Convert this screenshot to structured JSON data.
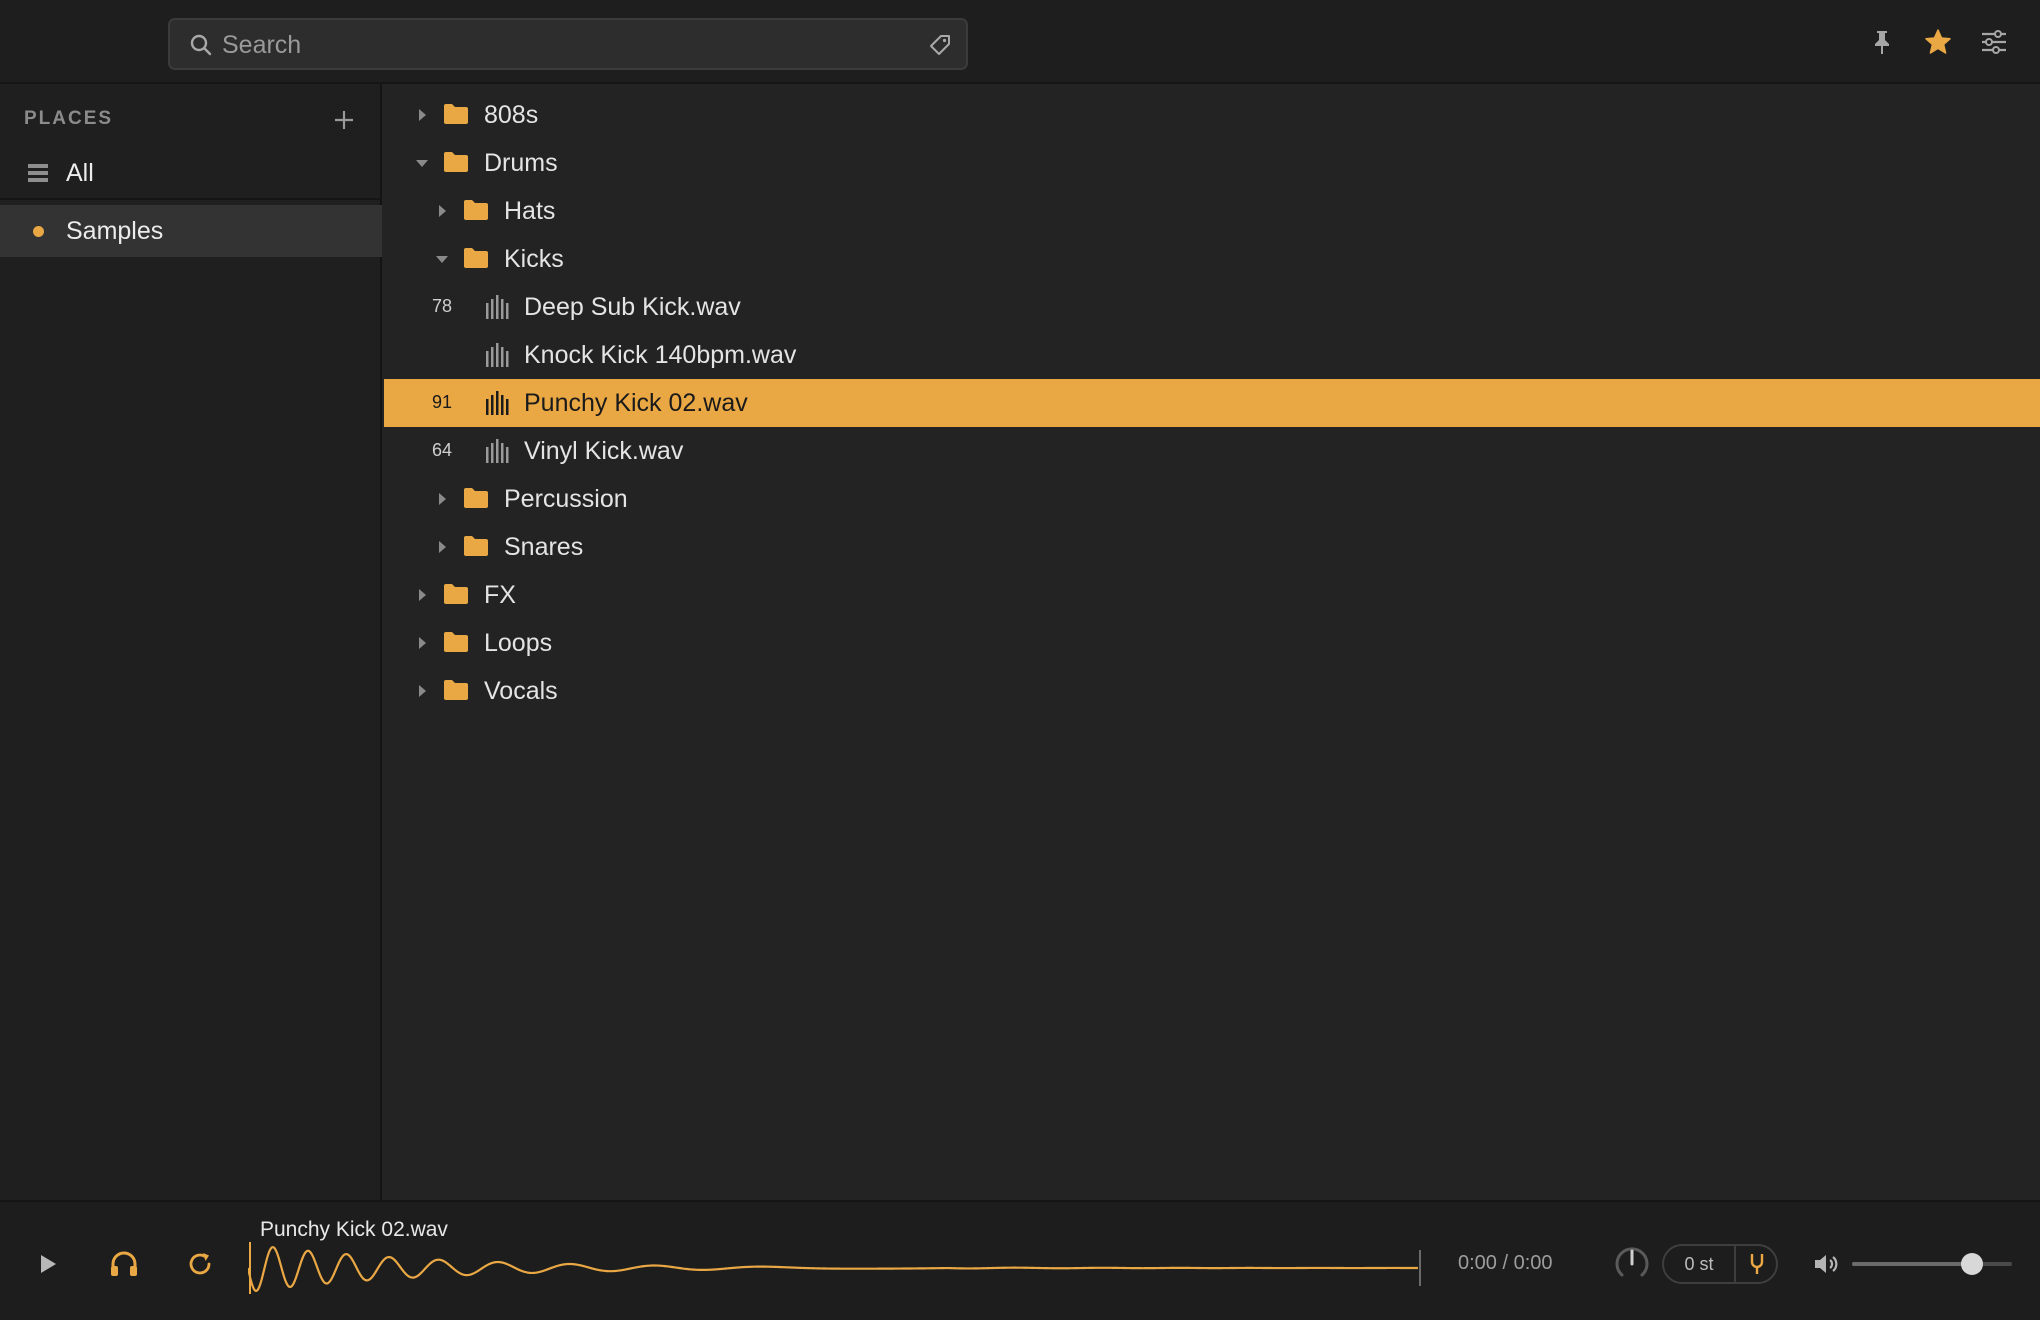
{
  "search": {
    "placeholder": "Search",
    "value": ""
  },
  "topbar_icons": [
    "pin-icon",
    "star-icon",
    "sliders-icon"
  ],
  "colors": {
    "accent": "#eaa845",
    "background": "#232323",
    "sidebar": "#1f1f1f",
    "topbar": "#1e1e1e"
  },
  "sidebar": {
    "heading": "PLACES",
    "items": [
      {
        "label": "All",
        "icon": "stack-icon",
        "active": false
      },
      {
        "label": "Samples",
        "icon": "dot-icon",
        "active": true
      }
    ]
  },
  "tree": [
    {
      "type": "folder",
      "name": "808s",
      "depth": 0,
      "expanded": false
    },
    {
      "type": "folder",
      "name": "Drums",
      "depth": 0,
      "expanded": true
    },
    {
      "type": "folder",
      "name": "Hats",
      "depth": 1,
      "expanded": false
    },
    {
      "type": "folder",
      "name": "Kicks",
      "depth": 1,
      "expanded": true
    },
    {
      "type": "file",
      "name": "Deep Sub Kick.wav",
      "number": "78",
      "selected": false
    },
    {
      "type": "file",
      "name": "Knock Kick 140bpm.wav",
      "number": "",
      "selected": false
    },
    {
      "type": "file",
      "name": "Punchy Kick 02.wav",
      "number": "91",
      "selected": true
    },
    {
      "type": "file",
      "name": "Vinyl Kick.wav",
      "number": "64",
      "selected": false
    },
    {
      "type": "folder",
      "name": "Percussion",
      "depth": 1,
      "expanded": false
    },
    {
      "type": "folder",
      "name": "Snares",
      "depth": 1,
      "expanded": false
    },
    {
      "type": "folder",
      "name": "FX",
      "depth": 0,
      "expanded": false
    },
    {
      "type": "folder",
      "name": "Loops",
      "depth": 0,
      "expanded": false
    },
    {
      "type": "folder",
      "name": "Vocals",
      "depth": 0,
      "expanded": false
    }
  ],
  "player": {
    "title": "Punchy Kick 02.wav",
    "time": "0:00 / 0:00",
    "pitch": "0 st",
    "volume": 0.75,
    "buttons": [
      "play-icon",
      "headphones-icon",
      "loop-icon"
    ]
  }
}
